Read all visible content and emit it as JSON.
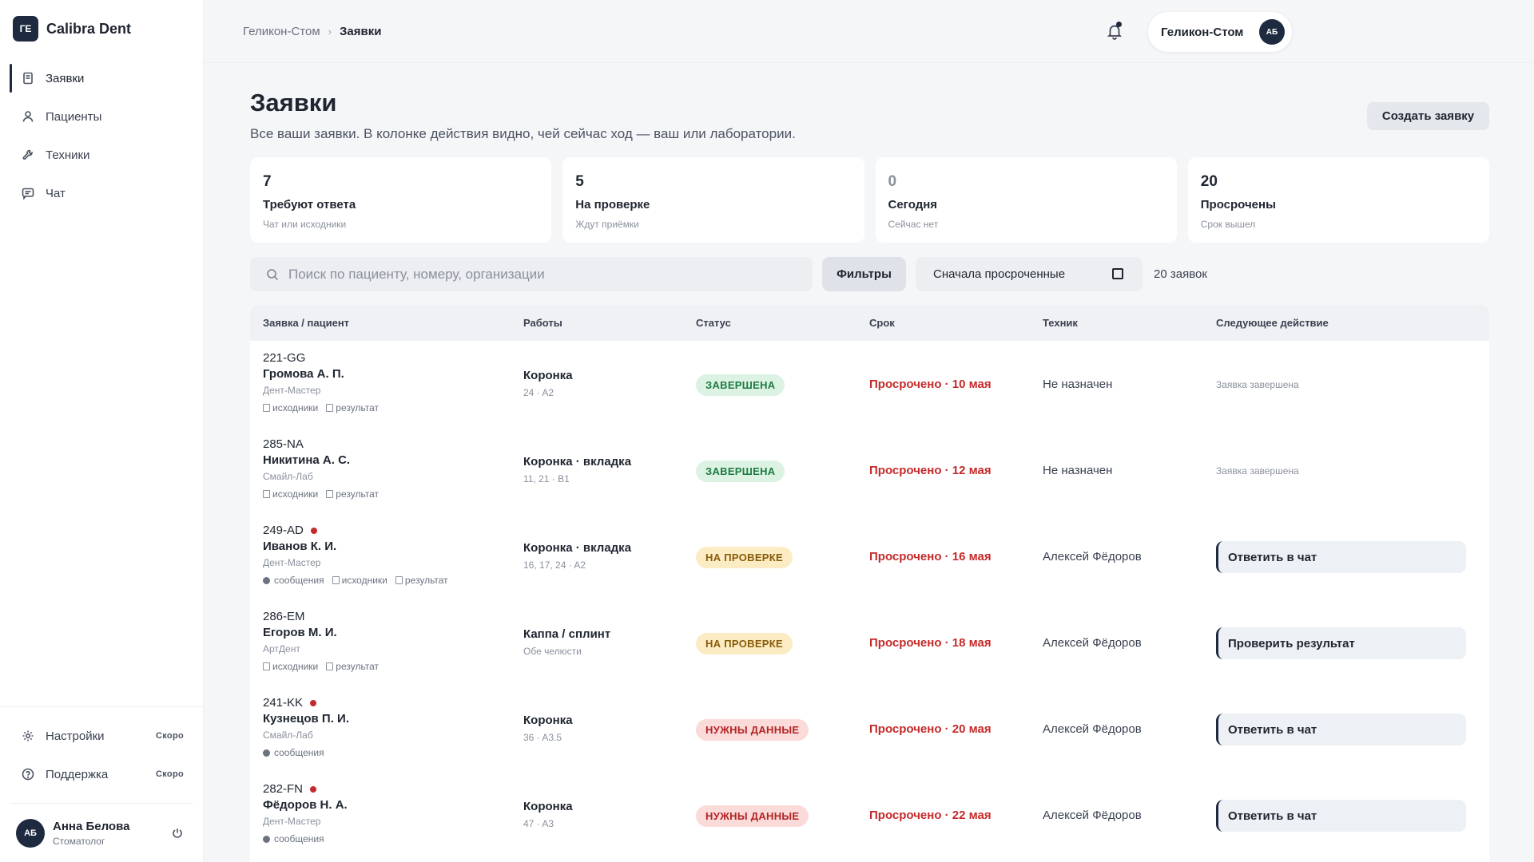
{
  "brand": {
    "logo": "ГЕ",
    "name": "Calibra Dent"
  },
  "nav": [
    {
      "label": "Заявки",
      "icon": "document-icon",
      "active": true
    },
    {
      "label": "Пациенты",
      "icon": "user-icon"
    },
    {
      "label": "Техники",
      "icon": "wrench-icon"
    },
    {
      "label": "Чат",
      "icon": "chat-icon"
    }
  ],
  "nav_bottom": [
    {
      "label": "Настройки",
      "badge": "Скоро",
      "icon": "gear-icon"
    },
    {
      "label": "Поддержка",
      "badge": "Скоро",
      "icon": "help-icon"
    }
  ],
  "user": {
    "initials": "АБ",
    "name": "Анна Белова",
    "role": "Стоматолог"
  },
  "breadcrumb": {
    "root": "Геликон-Стом",
    "sep": "›",
    "current": "Заявки"
  },
  "org": {
    "name": "Геликон-Стом",
    "initials": "АБ"
  },
  "page": {
    "title": "Заявки",
    "subtitle": "Все ваши заявки. В колонке действия видно, чей сейчас ход — ваш или лаборатории.",
    "create_label": "Создать заявку"
  },
  "stats": [
    {
      "value": "7",
      "label": "Требуют ответа",
      "hint": "Чат или исходники"
    },
    {
      "value": "5",
      "label": "На проверке",
      "hint": "Ждут приёмки"
    },
    {
      "value": "0",
      "label": "Сегодня",
      "hint": "Сейчас нет"
    },
    {
      "value": "20",
      "label": "Просрочены",
      "hint": "Срок вышел"
    }
  ],
  "toolbar": {
    "search_placeholder": "Поиск по пациенту, номеру, организации",
    "filters_label": "Фильтры",
    "sort_label": "Сначала просроченные",
    "count": "20 заявок"
  },
  "table": {
    "headers": [
      "Заявка / пациент",
      "Работы",
      "Статус",
      "Срок",
      "Техник",
      "Следующее действие"
    ],
    "rows": [
      {
        "id": "221-GG",
        "unread": false,
        "patient": "Громова А. П.",
        "clinic": "Дент-Мастер",
        "tags": [
          "исходники",
          "результат"
        ],
        "messages": false,
        "work": "Коронка",
        "work_detail": "24 · A2",
        "status": "ЗАВЕРШЕНА",
        "status_kind": "done",
        "due": "Просрочено · 10 мая",
        "tech": "Не назначен",
        "next": "Заявка завершена",
        "next_is_action": false
      },
      {
        "id": "285-NA",
        "unread": false,
        "patient": "Никитина А. С.",
        "clinic": "Смайл-Лаб",
        "tags": [
          "исходники",
          "результат"
        ],
        "messages": false,
        "work": "Коронка · вкладка",
        "work_detail": "11, 21 · B1",
        "status": "ЗАВЕРШЕНА",
        "status_kind": "done",
        "due": "Просрочено · 12 мая",
        "tech": "Не назначен",
        "next": "Заявка завершена",
        "next_is_action": false
      },
      {
        "id": "249-AD",
        "unread": true,
        "patient": "Иванов К. И.",
        "clinic": "Дент-Мастер",
        "tags": [
          "исходники",
          "результат"
        ],
        "messages": true,
        "work": "Коронка · вкладка",
        "work_detail": "16, 17, 24 · A2",
        "status": "НА ПРОВЕРКЕ",
        "status_kind": "review",
        "due": "Просрочено · 16 мая",
        "tech": "Алексей Фёдоров",
        "next": "Ответить в чат",
        "next_is_action": true
      },
      {
        "id": "286-EM",
        "unread": false,
        "patient": "Егоров М. И.",
        "clinic": "АртДент",
        "tags": [
          "исходники",
          "результат"
        ],
        "messages": false,
        "work": "Каппа / сплинт",
        "work_detail": "Обе челюсти",
        "status": "НА ПРОВЕРКЕ",
        "status_kind": "review",
        "due": "Просрочено · 18 мая",
        "tech": "Алексей Фёдоров",
        "next": "Проверить результат",
        "next_is_action": true
      },
      {
        "id": "241-KK",
        "unread": true,
        "patient": "Кузнецов П. И.",
        "clinic": "Смайл-Лаб",
        "tags": [],
        "messages": true,
        "work": "Коронка",
        "work_detail": "36 · A3.5",
        "status": "НУЖНЫ ДАННЫЕ",
        "status_kind": "data",
        "due": "Просрочено · 20 мая",
        "tech": "Алексей Фёдоров",
        "next": "Ответить в чат",
        "next_is_action": true
      },
      {
        "id": "282-FN",
        "unread": true,
        "patient": "Фёдоров Н. А.",
        "clinic": "Дент-Мастер",
        "tags": [],
        "messages": true,
        "work": "Коронка",
        "work_detail": "47 · A3",
        "status": "НУЖНЫ ДАННЫЕ",
        "status_kind": "data",
        "due": "Просрочено · 22 мая",
        "tech": "Алексей Фёдоров",
        "next": "Ответить в чат",
        "next_is_action": true
      }
    ],
    "messages_label": "сообщения"
  }
}
